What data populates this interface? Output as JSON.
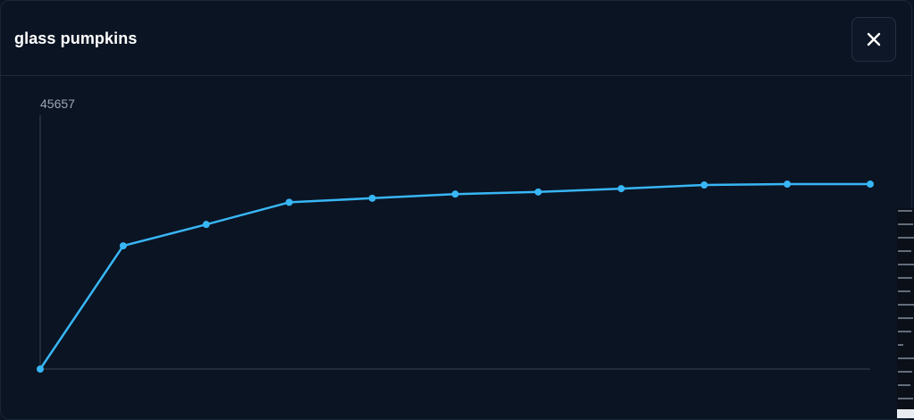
{
  "modal": {
    "title": "glass pumpkins"
  },
  "icons": {
    "close": "close-icon"
  },
  "colors": {
    "background": "#0b1423",
    "line": "#38b6f5",
    "axis": "#3a4656",
    "label": "#9aa6b6",
    "title": "#ffffff"
  },
  "chart_data": {
    "type": "line",
    "x": [
      1,
      2,
      3,
      4,
      5,
      6,
      7,
      8,
      9,
      10,
      11
    ],
    "values": [
      0,
      22170,
      26017,
      30003,
      30731,
      31482,
      31860,
      32458,
      33114,
      33275,
      33275
    ],
    "ylim": [
      0,
      45657
    ],
    "y_tick_labels": [
      "45657"
    ],
    "grid": false,
    "legend": "none"
  }
}
